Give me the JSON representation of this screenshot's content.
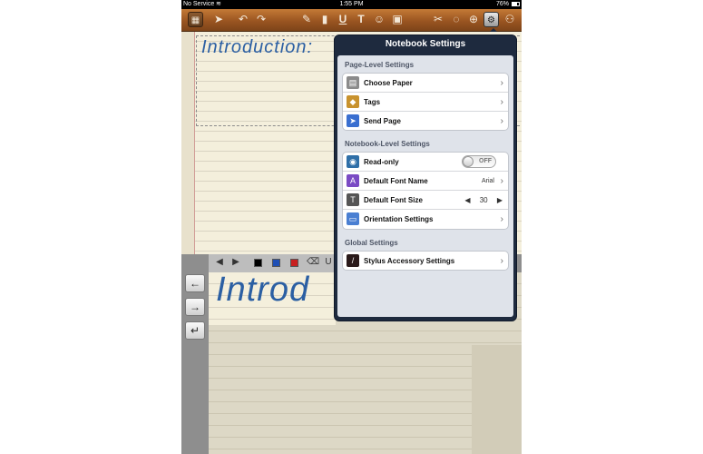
{
  "status_bar": {
    "carrier": "No Service",
    "time": "1:55 PM",
    "battery": "76%"
  },
  "toolbar": {
    "icons": [
      "grid-icon",
      "pointer-icon",
      "undo-icon",
      "redo-icon",
      "pen-icon",
      "highlighter-icon",
      "text-underline-icon",
      "text-tool-icon",
      "smiley-icon",
      "image-icon",
      "scissors-icon",
      "lasso-icon",
      "zoom-icon",
      "settings-icon",
      "share-icon"
    ]
  },
  "notebook": {
    "handwriting_top": "Introduction:",
    "handwriting_zoom": "Introd"
  },
  "popover": {
    "title": "Notebook Settings",
    "sections": [
      {
        "label": "Page-Level Settings",
        "rows": [
          {
            "label": "Choose Paper",
            "icon": "paper-icon",
            "icon_color": "#8b8b8b"
          },
          {
            "label": "Tags",
            "icon": "tag-icon",
            "icon_color": "#c8922e"
          },
          {
            "label": "Send Page",
            "icon": "send-icon",
            "icon_color": "#3a6fd0"
          }
        ]
      },
      {
        "label": "Notebook-Level Settings",
        "rows": [
          {
            "label": "Read-only",
            "icon": "eye-icon",
            "icon_color": "#2f6fa8",
            "toggle": "OFF"
          },
          {
            "label": "Default Font Name",
            "icon": "font-icon",
            "icon_color": "#7a4bc4",
            "value": "Arial"
          },
          {
            "label": "Default Font Size",
            "icon": "font-size-icon",
            "icon_color": "#555555",
            "stepper": "30"
          },
          {
            "label": "Orientation Settings",
            "icon": "orientation-icon",
            "icon_color": "#4a7fd2"
          }
        ]
      },
      {
        "label": "Global Settings",
        "rows": [
          {
            "label": "Stylus Accessory Settings",
            "icon": "stylus-icon",
            "icon_color": "#2a1a1a"
          }
        ]
      }
    ]
  },
  "colors": {
    "toolbar": "#9a5521",
    "popover_header": "#1e2a3e",
    "ink": "#2b5fa3",
    "swatches": [
      "#000000",
      "#1f4fb5",
      "#c82020"
    ]
  }
}
